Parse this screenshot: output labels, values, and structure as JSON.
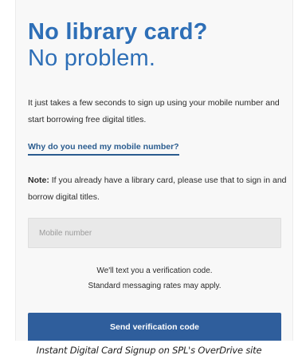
{
  "signup": {
    "headline_line1": "No library card?",
    "headline_line2": "No problem.",
    "intro": "It just takes a few seconds to sign up using your mobile number and start borrowing free digital titles.",
    "why_link": "Why do you need my mobile number?",
    "note_label": "Note:",
    "note_text": " If you already have a library card, please use that to sign in and borrow digital titles.",
    "mobile_placeholder": "Mobile number",
    "mobile_value": "",
    "helper_line1": "We'll text you a verification code.",
    "helper_line2": "Standard messaging rates may apply.",
    "send_button": "Send verification code"
  },
  "caption": "Instant Digital Card Signup on SPL's OverDrive site",
  "colors": {
    "headline": "#2e6fb7",
    "link": "#2a5c8f",
    "button": "#2f5e9c",
    "panel": "#f8f8f8",
    "input": "#e9e9e9"
  }
}
